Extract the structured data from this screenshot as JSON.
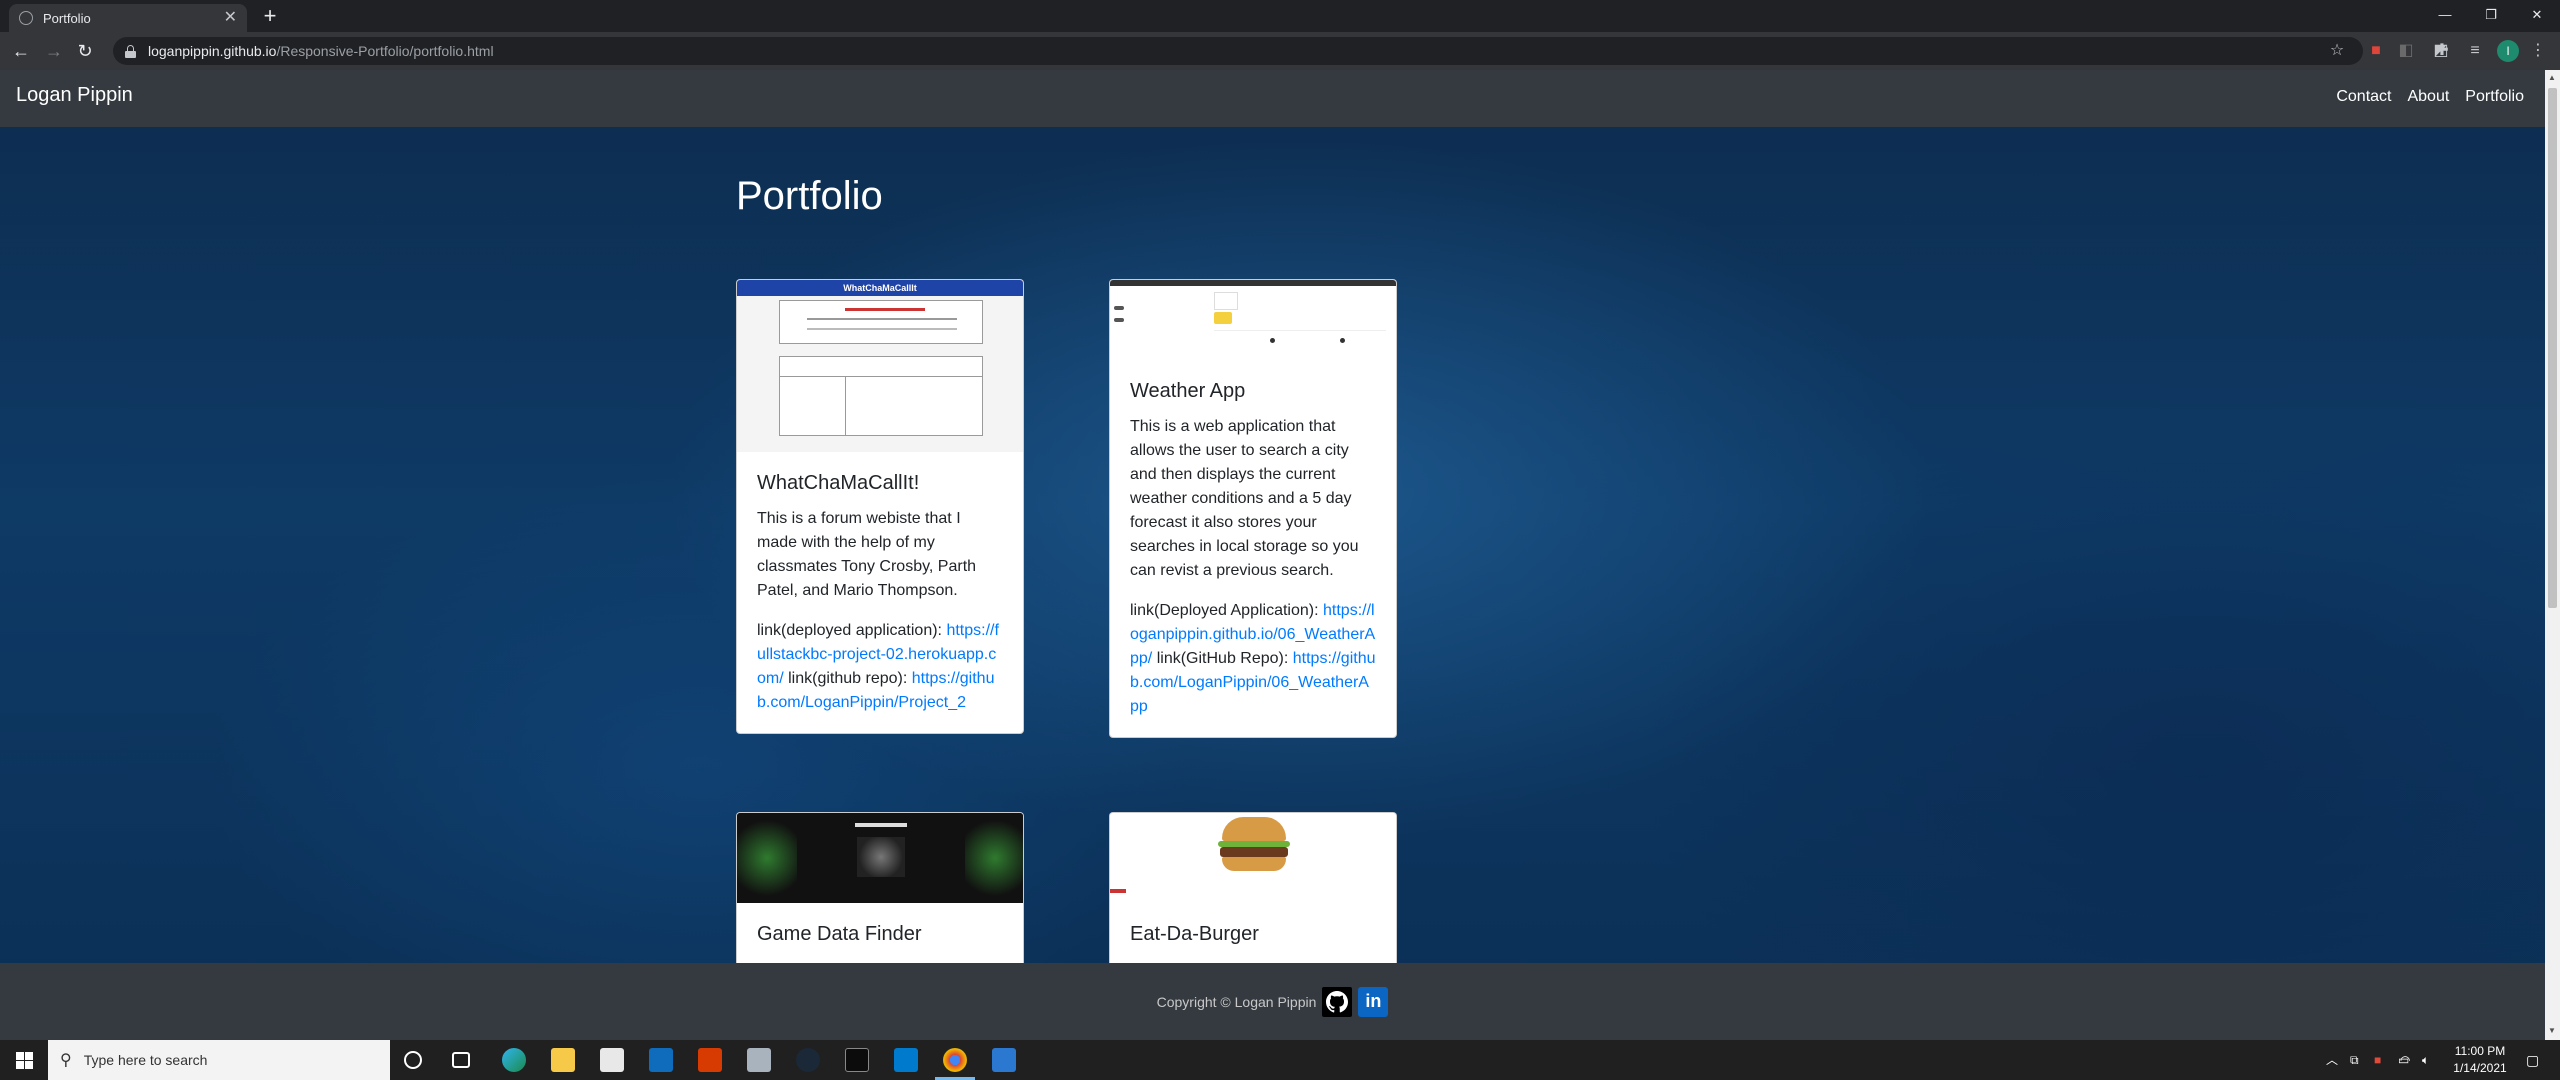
{
  "browser": {
    "tab_title": "Portfolio",
    "tab_close": "✕",
    "new_tab": "+",
    "url_host": "loganpippin.github.io",
    "url_path": "/Responsive-Portfolio/portfolio.html",
    "profile_initial": "I"
  },
  "site": {
    "brand": "Logan Pippin",
    "nav": [
      "Contact",
      "About",
      "Portfolio"
    ],
    "heading": "Portfolio"
  },
  "projects": [
    {
      "title": "WhatChaMaCallIt!",
      "shot_title": "WhatChaMaCallIt",
      "description": "This is a forum webiste that I made with the help of my classmates Tony Crosby, Parth Patel, and Mario Thompson.",
      "link1_label": "link(deployed application):",
      "link1_url": "https://fullstackbc-project-02.herokuapp.com/",
      "link2_label": "link(github repo):",
      "link2_url": "https://github.com/LoganPippin/Project_2"
    },
    {
      "title": "Weather App",
      "description": "This is a web application that allows the user to search a city and then displays the current weather conditions and a 5 day forecast it also stores your searches in local storage so you can revist a previous search.",
      "link1_label": "link(Deployed Application):",
      "link1_url": "https://loganpippin.github.io/06_WeatherApp/",
      "link2_label": "link(GitHub Repo):",
      "link2_url": "https://github.com/LoganPippin/06_WeatherApp"
    },
    {
      "title": "Game Data Finder"
    },
    {
      "title": "Eat-Da-Burger"
    }
  ],
  "footer": {
    "copyright": "Copyright © Logan Pippin",
    "linkedin_glyph": "in"
  },
  "taskbar": {
    "search_placeholder": "Type here to search",
    "time": "11:00 PM",
    "date": "1/14/2021"
  },
  "colors": {
    "link": "#007bff",
    "navbar": "#343a40",
    "page_bg": "#0e3a66"
  }
}
